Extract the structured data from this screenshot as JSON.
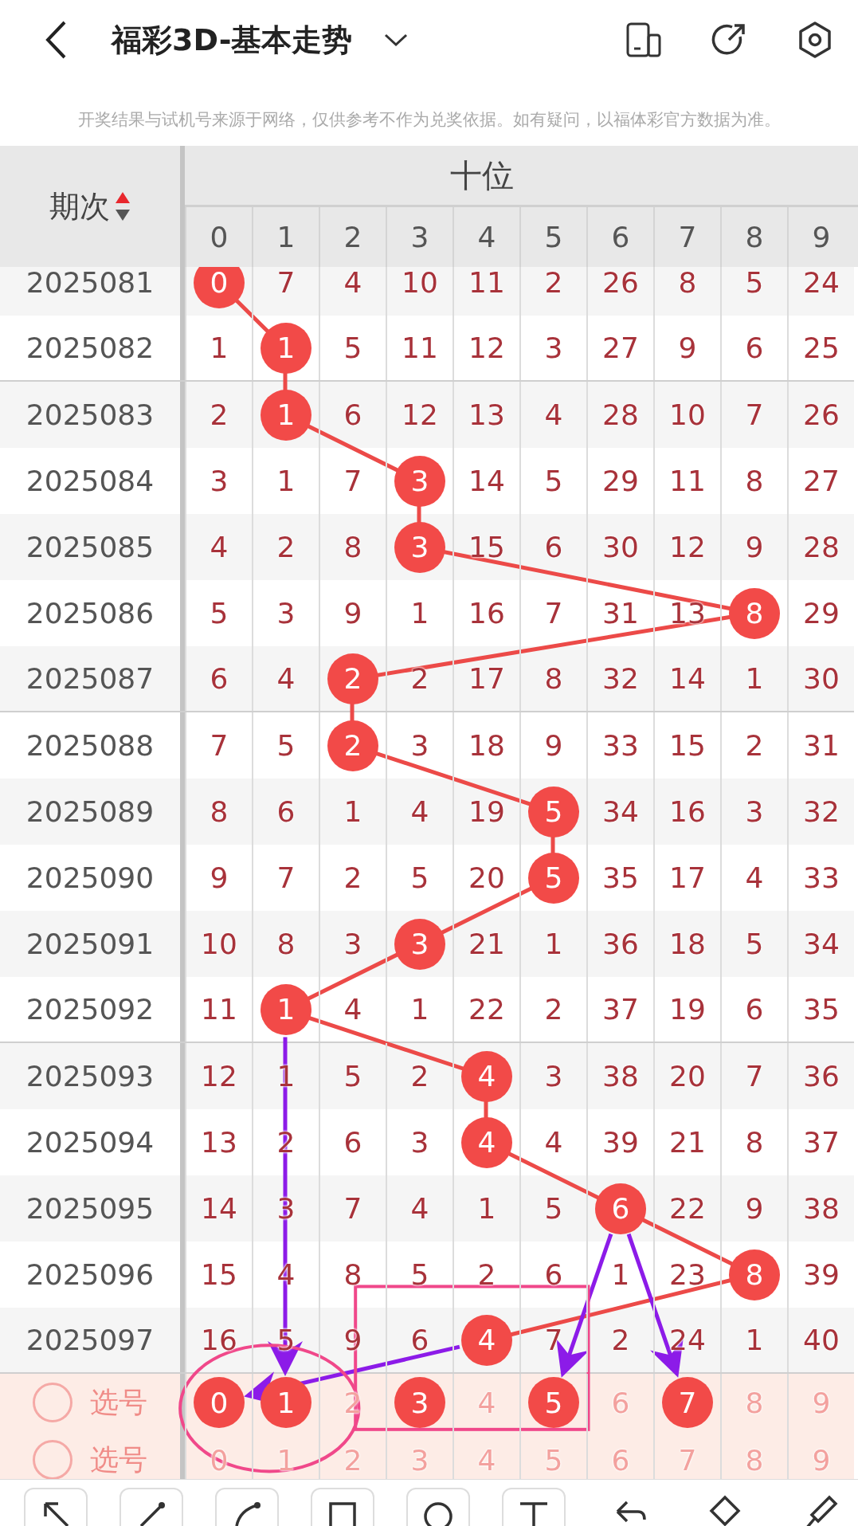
{
  "header": {
    "title": "福彩3D-基本走势"
  },
  "disclaimer": "开奖结果与试机号来源于网络，仅供参考不作为兑奖依据。如有疑问，以福体彩官方数据为准。",
  "table": {
    "issue_heading": "期次",
    "group_heading": "十位",
    "columns": [
      "0",
      "1",
      "2",
      "3",
      "4",
      "5",
      "6",
      "7",
      "8",
      "9"
    ],
    "rows": [
      {
        "issue": "2025081",
        "cells": [
          {
            "text": "0",
            "hit": true
          },
          {
            "text": "7",
            "hit": false
          },
          {
            "text": "4",
            "hit": false
          },
          {
            "text": "10",
            "hit": false
          },
          {
            "text": "11",
            "hit": false
          },
          {
            "text": "2",
            "hit": false
          },
          {
            "text": "26",
            "hit": false
          },
          {
            "text": "8",
            "hit": false
          },
          {
            "text": "5",
            "hit": false
          },
          {
            "text": "24",
            "hit": false
          }
        ]
      },
      {
        "issue": "2025082",
        "cells": [
          {
            "text": "1",
            "hit": false
          },
          {
            "text": "1",
            "hit": true
          },
          {
            "text": "5",
            "hit": false
          },
          {
            "text": "11",
            "hit": false
          },
          {
            "text": "12",
            "hit": false
          },
          {
            "text": "3",
            "hit": false
          },
          {
            "text": "27",
            "hit": false
          },
          {
            "text": "9",
            "hit": false
          },
          {
            "text": "6",
            "hit": false
          },
          {
            "text": "25",
            "hit": false
          }
        ]
      },
      {
        "issue": "2025083",
        "cells": [
          {
            "text": "2",
            "hit": false
          },
          {
            "text": "1",
            "hit": true
          },
          {
            "text": "6",
            "hit": false
          },
          {
            "text": "12",
            "hit": false
          },
          {
            "text": "13",
            "hit": false
          },
          {
            "text": "4",
            "hit": false
          },
          {
            "text": "28",
            "hit": false
          },
          {
            "text": "10",
            "hit": false
          },
          {
            "text": "7",
            "hit": false
          },
          {
            "text": "26",
            "hit": false
          }
        ]
      },
      {
        "issue": "2025084",
        "cells": [
          {
            "text": "3",
            "hit": false
          },
          {
            "text": "1",
            "hit": false
          },
          {
            "text": "7",
            "hit": false
          },
          {
            "text": "3",
            "hit": true
          },
          {
            "text": "14",
            "hit": false
          },
          {
            "text": "5",
            "hit": false
          },
          {
            "text": "29",
            "hit": false
          },
          {
            "text": "11",
            "hit": false
          },
          {
            "text": "8",
            "hit": false
          },
          {
            "text": "27",
            "hit": false
          }
        ]
      },
      {
        "issue": "2025085",
        "cells": [
          {
            "text": "4",
            "hit": false
          },
          {
            "text": "2",
            "hit": false
          },
          {
            "text": "8",
            "hit": false
          },
          {
            "text": "3",
            "hit": true
          },
          {
            "text": "15",
            "hit": false
          },
          {
            "text": "6",
            "hit": false
          },
          {
            "text": "30",
            "hit": false
          },
          {
            "text": "12",
            "hit": false
          },
          {
            "text": "9",
            "hit": false
          },
          {
            "text": "28",
            "hit": false
          }
        ]
      },
      {
        "issue": "2025086",
        "cells": [
          {
            "text": "5",
            "hit": false
          },
          {
            "text": "3",
            "hit": false
          },
          {
            "text": "9",
            "hit": false
          },
          {
            "text": "1",
            "hit": false
          },
          {
            "text": "16",
            "hit": false
          },
          {
            "text": "7",
            "hit": false
          },
          {
            "text": "31",
            "hit": false
          },
          {
            "text": "13",
            "hit": false
          },
          {
            "text": "8",
            "hit": true
          },
          {
            "text": "29",
            "hit": false
          }
        ]
      },
      {
        "issue": "2025087",
        "cells": [
          {
            "text": "6",
            "hit": false
          },
          {
            "text": "4",
            "hit": false
          },
          {
            "text": "2",
            "hit": true
          },
          {
            "text": "2",
            "hit": false
          },
          {
            "text": "17",
            "hit": false
          },
          {
            "text": "8",
            "hit": false
          },
          {
            "text": "32",
            "hit": false
          },
          {
            "text": "14",
            "hit": false
          },
          {
            "text": "1",
            "hit": false
          },
          {
            "text": "30",
            "hit": false
          }
        ]
      },
      {
        "issue": "2025088",
        "cells": [
          {
            "text": "7",
            "hit": false
          },
          {
            "text": "5",
            "hit": false
          },
          {
            "text": "2",
            "hit": true
          },
          {
            "text": "3",
            "hit": false
          },
          {
            "text": "18",
            "hit": false
          },
          {
            "text": "9",
            "hit": false
          },
          {
            "text": "33",
            "hit": false
          },
          {
            "text": "15",
            "hit": false
          },
          {
            "text": "2",
            "hit": false
          },
          {
            "text": "31",
            "hit": false
          }
        ]
      },
      {
        "issue": "2025089",
        "cells": [
          {
            "text": "8",
            "hit": false
          },
          {
            "text": "6",
            "hit": false
          },
          {
            "text": "1",
            "hit": false
          },
          {
            "text": "4",
            "hit": false
          },
          {
            "text": "19",
            "hit": false
          },
          {
            "text": "5",
            "hit": true
          },
          {
            "text": "34",
            "hit": false
          },
          {
            "text": "16",
            "hit": false
          },
          {
            "text": "3",
            "hit": false
          },
          {
            "text": "32",
            "hit": false
          }
        ]
      },
      {
        "issue": "2025090",
        "cells": [
          {
            "text": "9",
            "hit": false
          },
          {
            "text": "7",
            "hit": false
          },
          {
            "text": "2",
            "hit": false
          },
          {
            "text": "5",
            "hit": false
          },
          {
            "text": "20",
            "hit": false
          },
          {
            "text": "5",
            "hit": true
          },
          {
            "text": "35",
            "hit": false
          },
          {
            "text": "17",
            "hit": false
          },
          {
            "text": "4",
            "hit": false
          },
          {
            "text": "33",
            "hit": false
          }
        ]
      },
      {
        "issue": "2025091",
        "cells": [
          {
            "text": "10",
            "hit": false
          },
          {
            "text": "8",
            "hit": false
          },
          {
            "text": "3",
            "hit": false
          },
          {
            "text": "3",
            "hit": true
          },
          {
            "text": "21",
            "hit": false
          },
          {
            "text": "1",
            "hit": false
          },
          {
            "text": "36",
            "hit": false
          },
          {
            "text": "18",
            "hit": false
          },
          {
            "text": "5",
            "hit": false
          },
          {
            "text": "34",
            "hit": false
          }
        ]
      },
      {
        "issue": "2025092",
        "cells": [
          {
            "text": "11",
            "hit": false
          },
          {
            "text": "1",
            "hit": true
          },
          {
            "text": "4",
            "hit": false
          },
          {
            "text": "1",
            "hit": false
          },
          {
            "text": "22",
            "hit": false
          },
          {
            "text": "2",
            "hit": false
          },
          {
            "text": "37",
            "hit": false
          },
          {
            "text": "19",
            "hit": false
          },
          {
            "text": "6",
            "hit": false
          },
          {
            "text": "35",
            "hit": false
          }
        ]
      },
      {
        "issue": "2025093",
        "cells": [
          {
            "text": "12",
            "hit": false
          },
          {
            "text": "1",
            "hit": false
          },
          {
            "text": "5",
            "hit": false
          },
          {
            "text": "2",
            "hit": false
          },
          {
            "text": "4",
            "hit": true
          },
          {
            "text": "3",
            "hit": false
          },
          {
            "text": "38",
            "hit": false
          },
          {
            "text": "20",
            "hit": false
          },
          {
            "text": "7",
            "hit": false
          },
          {
            "text": "36",
            "hit": false
          }
        ]
      },
      {
        "issue": "2025094",
        "cells": [
          {
            "text": "13",
            "hit": false
          },
          {
            "text": "2",
            "hit": false
          },
          {
            "text": "6",
            "hit": false
          },
          {
            "text": "3",
            "hit": false
          },
          {
            "text": "4",
            "hit": true
          },
          {
            "text": "4",
            "hit": false
          },
          {
            "text": "39",
            "hit": false
          },
          {
            "text": "21",
            "hit": false
          },
          {
            "text": "8",
            "hit": false
          },
          {
            "text": "37",
            "hit": false
          }
        ]
      },
      {
        "issue": "2025095",
        "cells": [
          {
            "text": "14",
            "hit": false
          },
          {
            "text": "3",
            "hit": false
          },
          {
            "text": "7",
            "hit": false
          },
          {
            "text": "4",
            "hit": false
          },
          {
            "text": "1",
            "hit": false
          },
          {
            "text": "5",
            "hit": false
          },
          {
            "text": "6",
            "hit": true
          },
          {
            "text": "22",
            "hit": false
          },
          {
            "text": "9",
            "hit": false
          },
          {
            "text": "38",
            "hit": false
          }
        ]
      },
      {
        "issue": "2025096",
        "cells": [
          {
            "text": "15",
            "hit": false
          },
          {
            "text": "4",
            "hit": false
          },
          {
            "text": "8",
            "hit": false
          },
          {
            "text": "5",
            "hit": false
          },
          {
            "text": "2",
            "hit": false
          },
          {
            "text": "6",
            "hit": false
          },
          {
            "text": "1",
            "hit": false
          },
          {
            "text": "23",
            "hit": false
          },
          {
            "text": "8",
            "hit": true
          },
          {
            "text": "39",
            "hit": false
          }
        ]
      },
      {
        "issue": "2025097",
        "cells": [
          {
            "text": "16",
            "hit": false
          },
          {
            "text": "5",
            "hit": false
          },
          {
            "text": "9",
            "hit": false
          },
          {
            "text": "6",
            "hit": false
          },
          {
            "text": "4",
            "hit": true
          },
          {
            "text": "7",
            "hit": false
          },
          {
            "text": "2",
            "hit": false
          },
          {
            "text": "24",
            "hit": false
          },
          {
            "text": "1",
            "hit": false
          },
          {
            "text": "40",
            "hit": false
          }
        ]
      }
    ],
    "select_rows": [
      {
        "label": "选号",
        "checked": false,
        "digits": [
          {
            "text": "0",
            "selected": true
          },
          {
            "text": "1",
            "selected": true
          },
          {
            "text": "2",
            "selected": false
          },
          {
            "text": "3",
            "selected": true
          },
          {
            "text": "4",
            "selected": false
          },
          {
            "text": "5",
            "selected": true
          },
          {
            "text": "6",
            "selected": false
          },
          {
            "text": "7",
            "selected": true
          },
          {
            "text": "8",
            "selected": false
          },
          {
            "text": "9",
            "selected": false
          }
        ]
      },
      {
        "label": "选号",
        "checked": false,
        "digits": [
          {
            "text": "0",
            "selected": false
          },
          {
            "text": "1",
            "selected": false
          },
          {
            "text": "2",
            "selected": false
          },
          {
            "text": "3",
            "selected": false
          },
          {
            "text": "4",
            "selected": false
          },
          {
            "text": "5",
            "selected": false
          },
          {
            "text": "6",
            "selected": false
          },
          {
            "text": "7",
            "selected": false
          },
          {
            "text": "8",
            "selected": false
          },
          {
            "text": "9",
            "selected": false
          }
        ]
      }
    ]
  },
  "annotations": [
    {
      "kind": "arrow"
    },
    {
      "kind": "arrow"
    },
    {
      "kind": "arrow"
    },
    {
      "kind": "arrow"
    },
    {
      "kind": "ellipse"
    },
    {
      "kind": "rectangle"
    }
  ]
}
